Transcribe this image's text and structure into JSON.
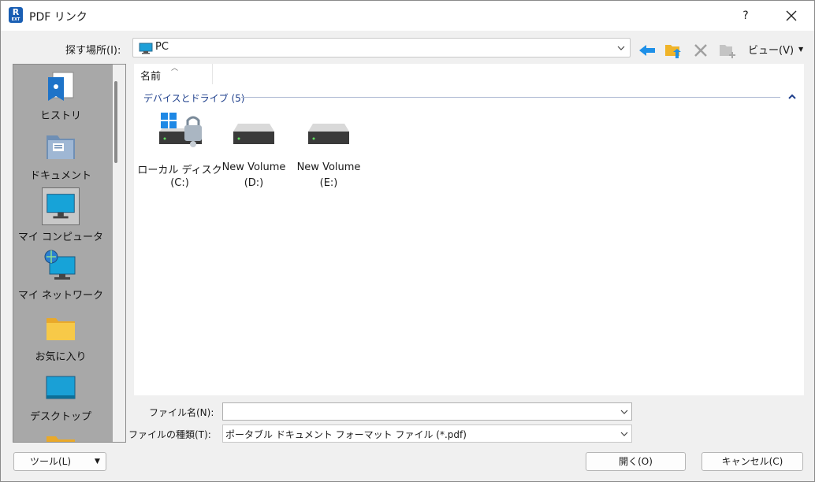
{
  "window": {
    "app_icon_letter": "R",
    "app_icon_sub": "EXT",
    "title": "PDF リンク",
    "help_label": "?"
  },
  "location": {
    "label": "探す場所(I):",
    "value": "PC"
  },
  "toolbar": {
    "back_icon": "back-arrow-icon",
    "up_icon": "up-folder-icon",
    "delete_icon": "delete-icon",
    "new_folder_icon": "new-folder-icon",
    "view_label": "ビュー(V)"
  },
  "places": [
    {
      "label": "ヒストリ",
      "icon": "history-icon"
    },
    {
      "label": "ドキュメント",
      "icon": "documents-icon"
    },
    {
      "label": "マイ コンピュータ",
      "icon": "computer-icon"
    },
    {
      "label": "マイ ネットワーク",
      "icon": "network-icon"
    },
    {
      "label": "お気に入り",
      "icon": "favorites-folder-icon"
    },
    {
      "label": "デスクトップ",
      "icon": "desktop-icon"
    }
  ],
  "filelist": {
    "column_name": "名前",
    "group_label": "デバイスとドライブ (5)",
    "drives": [
      {
        "line1": "ローカル ディスク",
        "line2": "(C:)",
        "icon": "local-disk-locked-icon"
      },
      {
        "line1": "New Volume",
        "line2": "(D:)",
        "icon": "drive-icon"
      },
      {
        "line1": "New Volume",
        "line2": "(E:)",
        "icon": "drive-icon"
      }
    ]
  },
  "filename": {
    "label": "ファイル名(N):",
    "value": ""
  },
  "filetype": {
    "label": "ファイルの種類(T):",
    "value": "ポータブル ドキュメント フォーマット ファイル (*.pdf)"
  },
  "buttons": {
    "tools": "ツール(L)",
    "open": "開く(O)",
    "cancel": "キャンセル(C)"
  },
  "colors": {
    "accent": "#1e90e8",
    "places_bg": "#a8a8a8",
    "group_header": "#1e3f8c"
  }
}
